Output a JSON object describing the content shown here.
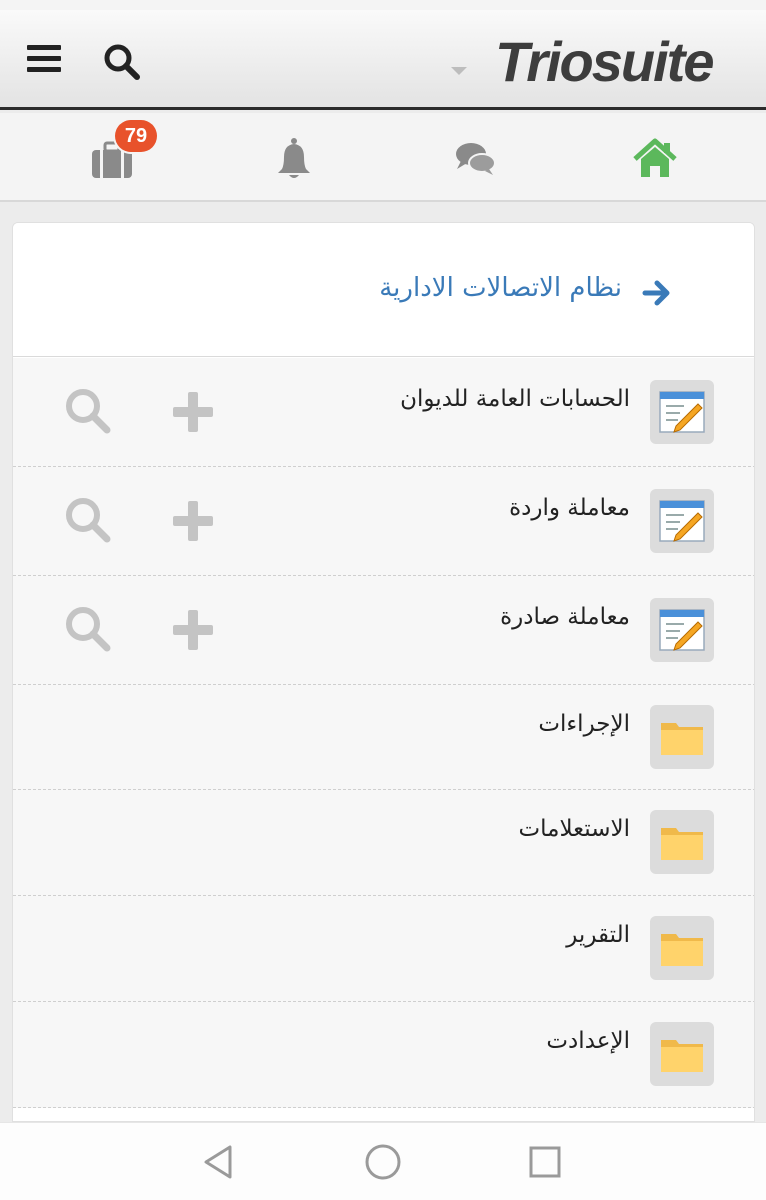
{
  "header": {
    "logo_text": "Triosuite",
    "menu_icon": "hamburger-icon",
    "search_icon": "search-icon",
    "dropdown_icon": "caret-down-icon"
  },
  "toolbar": {
    "items": [
      {
        "icon": "briefcase-icon",
        "badge": "79"
      },
      {
        "icon": "bell-icon"
      },
      {
        "icon": "chat-icon"
      },
      {
        "icon": "home-icon",
        "color": "#5cb85c"
      }
    ]
  },
  "panel": {
    "title": "نظام الاتصالات الادارية",
    "back_icon": "arrow-right-icon",
    "rows": [
      {
        "label": "الحسابات العامة للديوان",
        "icon": "form-edit-icon",
        "actions": [
          "add-icon",
          "search-icon"
        ]
      },
      {
        "label": "معاملة واردة",
        "icon": "form-edit-icon",
        "actions": [
          "add-icon",
          "search-icon"
        ]
      },
      {
        "label": "معاملة صادرة",
        "icon": "form-edit-icon",
        "actions": [
          "add-icon",
          "search-icon"
        ]
      },
      {
        "label": "الإجراءات",
        "icon": "folder-icon"
      },
      {
        "label": "الاستعلامات",
        "icon": "folder-icon"
      },
      {
        "label": "التقرير",
        "icon": "folder-icon"
      },
      {
        "label": "الإعدادت",
        "icon": "folder-icon"
      }
    ]
  },
  "colors": {
    "accent_blue": "#3a7ab8",
    "badge_red": "#e8522b",
    "home_green": "#5cb85c",
    "folder_yellow": "#ffd36b"
  },
  "navbar": {
    "buttons": [
      "back-triangle-icon",
      "home-circle-icon",
      "recents-square-icon"
    ]
  }
}
